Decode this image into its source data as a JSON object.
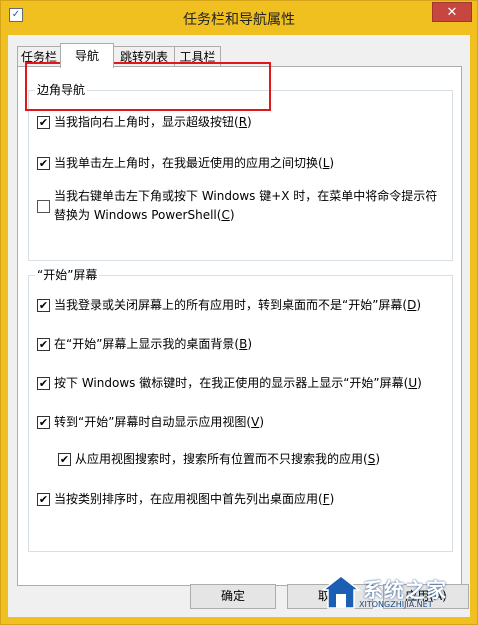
{
  "window": {
    "title": "任务栏和导航属性",
    "close_glyph": "✕",
    "app_icon": "checkmark-doc-icon"
  },
  "tabs": [
    {
      "label": "任务栏"
    },
    {
      "label": "导航"
    },
    {
      "label": "跳转列表"
    },
    {
      "label": "工具栏"
    }
  ],
  "active_tab": 1,
  "corner_nav": {
    "title": "边角导航",
    "options": [
      {
        "text_pre": "当我指向右上角时，显示超级按钮(",
        "key": "R",
        "text_post": ")",
        "checked": true
      },
      {
        "text_pre": "当我单击左上角时，在我最近使用的应用之间切换(",
        "key": "L",
        "text_post": ")",
        "checked": true
      },
      {
        "text_pre": "当我右键单击左下角或按下 Windows 键+X 时，在菜单中将命令提示符替换为 Windows PowerShell(",
        "key": "C",
        "text_post": ")",
        "checked": false
      }
    ]
  },
  "start_screen": {
    "title": "“开始”屏幕",
    "options": [
      {
        "text_pre": "当我登录或关闭屏幕上的所有应用时，转到桌面而不是“开始”屏幕(",
        "key": "D",
        "text_post": ")",
        "checked": true
      },
      {
        "text_pre": "在“开始”屏幕上显示我的桌面背景(",
        "key": "B",
        "text_post": ")",
        "checked": true
      },
      {
        "text_pre": "按下 Windows 徽标键时，在我正使用的显示器上显示“开始”屏幕(",
        "key": "U",
        "text_post": ")",
        "checked": true
      },
      {
        "text_pre": "转到“开始”屏幕时自动显示应用视图(",
        "key": "V",
        "text_post": ")",
        "checked": true
      },
      {
        "text_pre": "从应用视图搜索时，搜索所有位置而不只搜索我的应用(",
        "key": "S",
        "text_post": ")",
        "checked": true
      },
      {
        "text_pre": "当按类别排序时，在应用视图中首先列出桌面应用(",
        "key": "F",
        "text_post": ")",
        "checked": true
      }
    ]
  },
  "buttons": {
    "ok": "确定",
    "cancel": "取消",
    "apply": "应用(A)"
  },
  "watermark": {
    "title": "系统之家",
    "url": "XITONGZHIJIA.NET"
  },
  "colors": {
    "title_bar": "#f0c020",
    "close_button": "#c7463f",
    "highlight": "#e0181b"
  }
}
